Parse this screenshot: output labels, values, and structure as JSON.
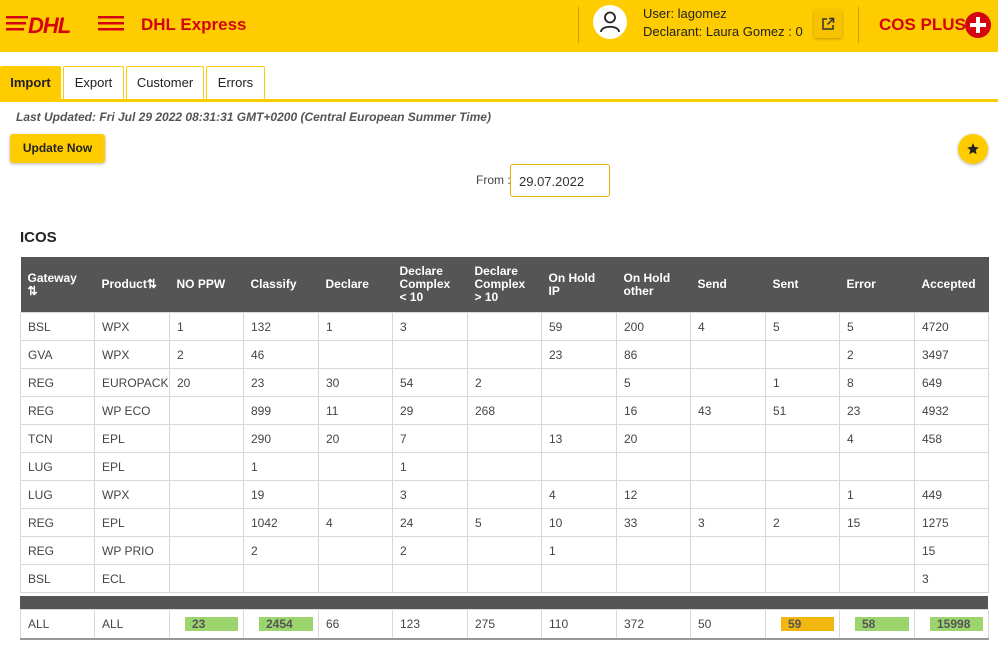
{
  "header": {
    "logo_text": "DHL",
    "brand": "DHL Express",
    "user_line": "User: lagomez",
    "declarant_line": "Declarant: Laura Gomez : 0",
    "app_name": "COS PLUS"
  },
  "tabs": [
    {
      "label": "Import",
      "active": true
    },
    {
      "label": "Export",
      "active": false
    },
    {
      "label": "Customer",
      "active": false
    },
    {
      "label": "Errors",
      "active": false
    }
  ],
  "last_updated": "Last Updated: Fri Jul 29 2022 08:31:31 GMT+0200 (Central European Summer Time)",
  "update_button": "Update Now",
  "from": {
    "label": "From :",
    "value": "29.07.2022"
  },
  "section_title": "ICOS",
  "table": {
    "columns": [
      "Gateway",
      "Product",
      "NO PPW",
      "Classify",
      "Declare",
      "Declare Complex < 10",
      "Declare Complex > 10",
      "On Hold IP",
      "On Hold other",
      "Send",
      "Sent",
      "Error",
      "Accepted"
    ],
    "sort_icon": "⇅",
    "rows": [
      [
        "BSL",
        "WPX",
        "1",
        "132",
        "1",
        "3",
        "",
        "59",
        "200",
        "4",
        "5",
        "5",
        "4720"
      ],
      [
        "GVA",
        "WPX",
        "2",
        "46",
        "",
        "",
        "",
        "23",
        "86",
        "",
        "",
        "2",
        "3497"
      ],
      [
        "REG",
        "EUROPACK",
        "20",
        "23",
        "30",
        "54",
        "2",
        "",
        "5",
        "",
        "1",
        "8",
        "649"
      ],
      [
        "REG",
        "WP ECO",
        "",
        "899",
        "11",
        "29",
        "268",
        "",
        "16",
        "43",
        "51",
        "23",
        "4932"
      ],
      [
        "TCN",
        "EPL",
        "",
        "290",
        "20",
        "7",
        "",
        "13",
        "20",
        "",
        "",
        "4",
        "458"
      ],
      [
        "LUG",
        "EPL",
        "",
        "1",
        "",
        "1",
        "",
        "",
        "",
        "",
        "",
        "",
        ""
      ],
      [
        "LUG",
        "WPX",
        "",
        "19",
        "",
        "3",
        "",
        "4",
        "12",
        "",
        "",
        "1",
        "449"
      ],
      [
        "REG",
        "EPL",
        "",
        "1042",
        "4",
        "24",
        "5",
        "10",
        "33",
        "3",
        "2",
        "15",
        "1275"
      ],
      [
        "REG",
        "WP PRIO",
        "",
        "2",
        "",
        "2",
        "",
        "1",
        "",
        "",
        "",
        "",
        "15"
      ],
      [
        "BSL",
        "ECL",
        "",
        "",
        "",
        "",
        "",
        "",
        "",
        "",
        "",
        "",
        "3"
      ]
    ],
    "totals": [
      "ALL",
      "ALL",
      "23",
      "2454",
      "66",
      "123",
      "275",
      "110",
      "372",
      "50",
      "59",
      "58",
      "15998"
    ],
    "totals_highlight": [
      "",
      "",
      "green",
      "green",
      "",
      "",
      "",
      "",
      "",
      "",
      "orange",
      "green",
      "green"
    ]
  },
  "colors": {
    "brand_yellow": "#ffcc00",
    "brand_red": "#d40511",
    "green": "#9cd56e",
    "orange": "#f2b70f"
  },
  "icons": [
    "user-icon",
    "external-link-icon",
    "swiss-cross-icon",
    "star-icon",
    "sort-icon"
  ]
}
